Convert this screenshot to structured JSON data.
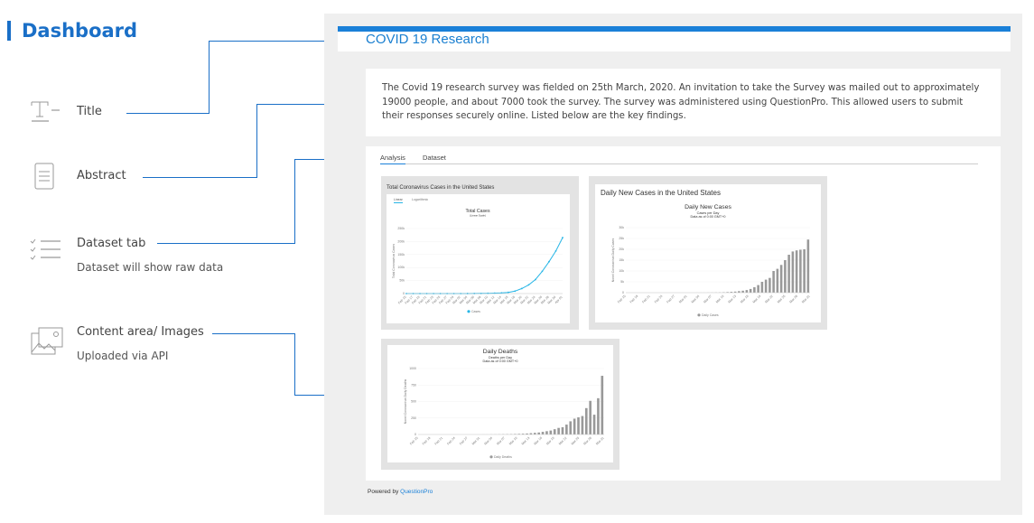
{
  "colors": {
    "accent": "#1a6fc7",
    "brand_bar": "#1a80d8",
    "bar_gray": "#999999",
    "line_blue": "#29b6e6"
  },
  "page": {
    "heading": "Dashboard"
  },
  "legend": [
    {
      "icon": "title-icon",
      "label": "Title",
      "sub": ""
    },
    {
      "icon": "document-icon",
      "label": "Abstract",
      "sub": ""
    },
    {
      "icon": "checklist-icon",
      "label": "Dataset tab",
      "sub": "Dataset will show raw data"
    },
    {
      "icon": "image-icon",
      "label": "Content area/ Images",
      "sub": "Uploaded via API"
    }
  ],
  "dashboard": {
    "title": "COVID 19 Research",
    "abstract": "The Covid 19 research survey was fielded on 25th March, 2020. An invitation to take the Survey was mailed out to approximately 19000 people, and about 7000 took the survey. The survey was administered using QuestionPro. This allowed users to submit their responses securely online. Listed below are the key findings.",
    "tabs": [
      "Analysis",
      "Dataset"
    ],
    "active_tab": "Analysis",
    "powered_by_prefix": "Powered by ",
    "powered_by_brand": "QuestionPro"
  },
  "chart_data": [
    {
      "type": "line",
      "card_title": "Total Coronavirus Cases in the United States",
      "subtabs": [
        "Linear",
        "Logarithmic"
      ],
      "title": "Total Cases",
      "subtitle": "(Linear Scale)",
      "ylabel": "Total Coronavirus Cases",
      "yticks": [
        "0",
        "50k",
        "100k",
        "150k",
        "200k",
        "250k"
      ],
      "ylim": [
        0,
        250000
      ],
      "x": [
        "Feb 15",
        "Feb 17",
        "Feb 19",
        "Feb 21",
        "Feb 23",
        "Feb 25",
        "Feb 27",
        "Feb 29",
        "Mar 02",
        "Mar 04",
        "Mar 06",
        "Mar 08",
        "Mar 10",
        "Mar 12",
        "Mar 14",
        "Mar 16",
        "Mar 18",
        "Mar 20",
        "Mar 22",
        "Mar 24",
        "Mar 26",
        "Mar 28",
        "Mar 30",
        "Apr 01"
      ],
      "series": [
        {
          "name": "Cases",
          "values": [
            15,
            15,
            15,
            15,
            15,
            15,
            20,
            30,
            100,
            150,
            300,
            550,
            1000,
            1650,
            2700,
            4600,
            9400,
            19400,
            33300,
            53700,
            85400,
            122600,
            163500,
            215000
          ]
        }
      ]
    },
    {
      "type": "bar",
      "card_title": "Daily New Cases in the United States",
      "title": "Daily New Cases",
      "subtitle": "Cases per Day",
      "note": "Data as of 0:00 GMT+0",
      "ylabel": "Novel Coronavirus Daily Cases",
      "yticks": [
        "0",
        "5k",
        "10k",
        "15k",
        "20k",
        "25k",
        "30k"
      ],
      "ylim": [
        0,
        30000
      ],
      "x_labels": [
        "Feb 15",
        "Feb 18",
        "Feb 21",
        "Feb 24",
        "Feb 27",
        "Mar 01",
        "Mar 04",
        "Mar 07",
        "Mar 10",
        "Mar 13",
        "Mar 16",
        "Mar 19",
        "Mar 22",
        "Mar 25",
        "Mar 28",
        "Mar 31"
      ],
      "series": [
        {
          "name": "Daily Cases",
          "values": [
            0,
            0,
            0,
            0,
            0,
            0,
            0,
            0,
            0,
            0,
            0,
            0,
            0,
            0,
            0,
            0,
            0,
            10,
            20,
            20,
            30,
            40,
            60,
            90,
            120,
            200,
            300,
            400,
            500,
            700,
            900,
            1200,
            1700,
            2500,
            3500,
            5000,
            6000,
            6800,
            10000,
            11000,
            12800,
            15000,
            17500,
            19000,
            19500,
            19800,
            20000,
            24500
          ]
        }
      ]
    },
    {
      "type": "bar",
      "title": "Daily Deaths",
      "subtitle": "Deaths per Day",
      "note": "Data as of 0:00 GMT+0",
      "ylabel": "Novel Coronavirus Daily Deaths",
      "yticks": [
        "0",
        "250",
        "500",
        "750",
        "1000"
      ],
      "ylim": [
        0,
        1000
      ],
      "x_labels": [
        "Feb 15",
        "Feb 18",
        "Feb 21",
        "Feb 24",
        "Feb 27",
        "Mar 01",
        "Mar 04",
        "Mar 07",
        "Mar 10",
        "Mar 13",
        "Mar 16",
        "Mar 19",
        "Mar 22",
        "Mar 25",
        "Mar 28",
        "Mar 31"
      ],
      "series": [
        {
          "name": "Daily Deaths",
          "values": [
            0,
            0,
            0,
            0,
            0,
            0,
            0,
            0,
            0,
            0,
            0,
            0,
            0,
            0,
            0,
            0,
            1,
            1,
            2,
            2,
            3,
            4,
            5,
            6,
            8,
            10,
            12,
            15,
            20,
            25,
            30,
            40,
            50,
            60,
            80,
            100,
            110,
            150,
            200,
            240,
            260,
            280,
            400,
            510,
            300,
            550,
            890
          ]
        }
      ]
    }
  ]
}
